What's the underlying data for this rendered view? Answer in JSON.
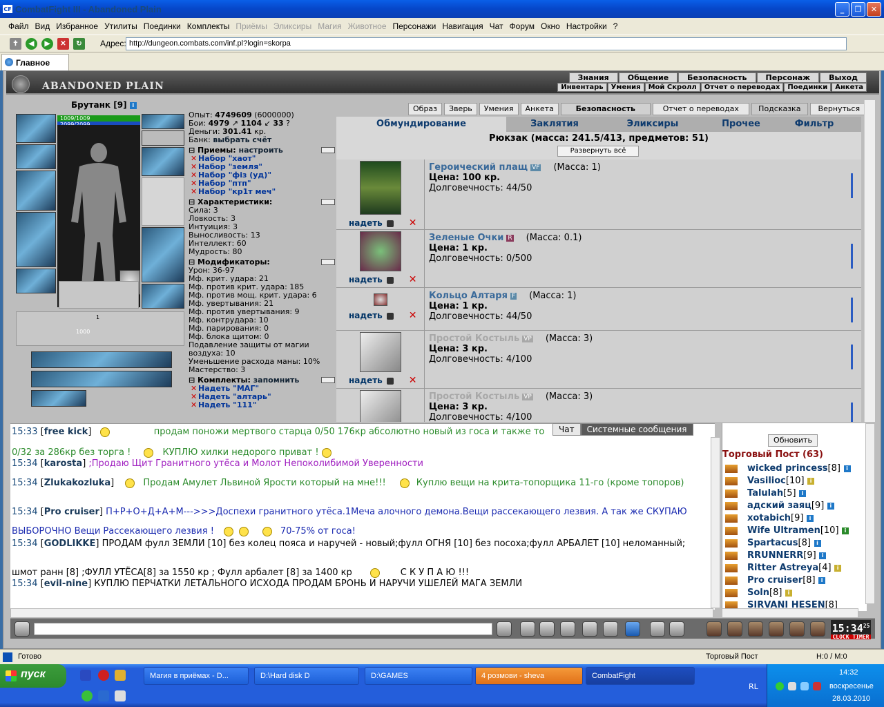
{
  "window": {
    "title": "CombatFight III - Abandoned Plain",
    "app_icon": "CF"
  },
  "menu": [
    {
      "label": "Файл",
      "enabled": true
    },
    {
      "label": "Вид",
      "enabled": true
    },
    {
      "label": "Избранное",
      "enabled": true
    },
    {
      "label": "Утилиты",
      "enabled": true
    },
    {
      "label": "Поединки",
      "enabled": true
    },
    {
      "label": "Комплекты",
      "enabled": true
    },
    {
      "label": "Приёмы",
      "enabled": false
    },
    {
      "label": "Эликсиры",
      "enabled": false
    },
    {
      "label": "Магия",
      "enabled": false
    },
    {
      "label": "Животное",
      "enabled": false
    },
    {
      "label": "Персонажи",
      "enabled": true
    },
    {
      "label": "Навигация",
      "enabled": true
    },
    {
      "label": "Чат",
      "enabled": true
    },
    {
      "label": "Форум",
      "enabled": true
    },
    {
      "label": "Окно",
      "enabled": true
    },
    {
      "label": "Настройки",
      "enabled": true
    },
    {
      "label": "?",
      "enabled": true
    }
  ],
  "address": {
    "label": "Адрес:",
    "url": "http://dungeon.combats.com/inf.pl?login=skorpa"
  },
  "browser_tab": {
    "label": "Главное"
  },
  "game": {
    "title": "ABANDONED PLAIN",
    "nav1": [
      "Знания",
      "Общение",
      "Безопасность",
      "Персонаж",
      "Выход"
    ],
    "nav2": [
      "Инвентарь",
      "Умения",
      "Мой Скролл",
      "Отчет о переводах",
      "Поединки",
      "Анкета"
    ]
  },
  "character": {
    "name": "Брутанк",
    "level": "[9]",
    "hp": "1009/1009",
    "mp": "2099/2099",
    "stack_count": "1000",
    "stack_count2": "1"
  },
  "stats": {
    "exp": {
      "label": "Опыт:",
      "value": "4749609",
      "extra": "(6000000)"
    },
    "fights": {
      "label": "Бои:",
      "wins": "4979",
      "losses": "1104",
      "draws": "33"
    },
    "money": {
      "label": "Деньги:",
      "value": "301.41",
      "unit": "кр."
    },
    "bank": {
      "label": "Банк:",
      "link": "выбрать счёт"
    },
    "tricks": {
      "title": "Приемы:",
      "link": "настроить",
      "sets": [
        "Набор \"хаот\"",
        "Набор \"земля\"",
        "Набор \"фіз (уд)\"",
        "Набор \"птп\"",
        "Набор \"кр1т меч\""
      ]
    },
    "chars": {
      "title": "Характеристики:",
      "lines": [
        "Сила: 3",
        "Ловкость: 3",
        "Интуиция: 3",
        "Выносливость: 13",
        "Интеллект: 60",
        "Мудрость: 80"
      ]
    },
    "mods": {
      "title": "Модификаторы:",
      "lines": [
        "Урон: 36-97",
        "Мф. крит. удара: 21",
        "Мф. против крит. удара: 185",
        "Мф. против мощ. крит. удара: 6",
        "Мф. увертывания: 21",
        "Мф. против увертывания: 9",
        "Мф. контрудара: 10",
        "Мф. парирования: 0",
        "Мф. блока щитом: 0",
        "Подавление защиты от магии",
        "воздуха: 10",
        "Уменьшение расхода маны: 10%",
        "Мастерство: 3"
      ]
    },
    "kits": {
      "title": "Комплекты:",
      "link": "запомнить",
      "sets": [
        "Надеть \"МАГ\"",
        "Надеть \"алтарь\"",
        "Надеть \"111\""
      ]
    }
  },
  "buttons": [
    "Образ",
    "Зверь",
    "Умения",
    "Анкета",
    "Безопасность",
    "Отчет о переводах",
    "Подсказка",
    "Вернуться"
  ],
  "inv_tabs": [
    "Обмундирование",
    "Заклятия",
    "Эликсиры",
    "Прочее",
    "Фильтр"
  ],
  "backpack": {
    "text": "Рюкзак (масса: 241.5/413, предметов: 51)",
    "expand": "Развернуть всё"
  },
  "items": [
    {
      "name": "Героический плащ",
      "tag": "VF",
      "mass": "(Масса: 1)",
      "price": "Цена: 100 кр.",
      "dur": "Долговечность: 44/50",
      "wear": "надеть",
      "grey": false
    },
    {
      "name": "Зеленые Очки",
      "tag": "R",
      "mass": "(Масса: 0.1)",
      "price": "Цена: 1 кр.",
      "dur": "Долговечность: 0/500",
      "wear": "надеть",
      "grey": false
    },
    {
      "name": "Кольцо Алтаря",
      "tag": "F",
      "mass": "(Масса: 1)",
      "price": "Цена: 1 кр.",
      "dur": "Долговечность: 44/50",
      "wear": "надеть",
      "grey": false
    },
    {
      "name": "Простой Костыль",
      "tag": "VP",
      "mass": "(Масса: 3)",
      "price": "Цена: 3 кр.",
      "dur": "Долговечность: 4/100",
      "wear": "надеть",
      "grey": true
    },
    {
      "name": "Простой Костыль",
      "tag": "VP",
      "mass": "(Масса: 3)",
      "price": "Цена: 3 кр.",
      "dur": "Долговечность: 4/100",
      "wear": "",
      "grey": true
    }
  ],
  "chat_tabs": [
    "Чат",
    "Системные сообщения"
  ],
  "chat": [
    {
      "time": "15:33",
      "nick": "free kick",
      "text": "продам поножи мертвого старца 0/50 176кр абсолютно новый из госа и также то",
      "color": "green"
    },
    {
      "time": "",
      "nick": "",
      "text": "0/32 за 286кр без торга ! ",
      "text2": "КУПЛЮ хилки недорого приват !",
      "color": "green"
    },
    {
      "time": "15:34",
      "nick": "karosta",
      "text": ";Продаю Щит Гранитного утёса и Молот Непоколибимой Уверенности",
      "color": "purple"
    },
    {
      "time": "15:34",
      "nick": "Zlukakozluka",
      "text": "Продам Амулет Львиной Ярости который на мне!!!",
      "text2": "Куплю вещи на крита-топорщика 11-го (кроме топоров)",
      "color": "green"
    },
    {
      "time": "15:34",
      "nick": "Pro cruiser",
      "text": "П+Р+О+Д+А+М--->>>Доспехи гранитного утёса.1Меча алочного демона.Вещи рассекающего лезвия. А так же СКУПАЮ",
      "color": "blue"
    },
    {
      "time": "",
      "nick": "",
      "text": "ВЫБОРОЧНО Вещи Рассекающего лезвия !",
      "text2": "70-75% от госа!",
      "color": "blue"
    },
    {
      "time": "15:34",
      "nick": "GODLIKKE",
      "text": "ПРОДАМ фулл ЗЕМЛИ [10] без колец пояса и наручей - новый;фулл ОГНЯ [10] без посоха;фулл АРБАЛЕТ [10] неломанный;",
      "color": "black"
    },
    {
      "time": "",
      "nick": "",
      "text": "шмот ранн [8] ;ФУЛЛ УТЁСА[8] за 1550 кр ; Фулл арбалет [8] за 1400 кр",
      "text2": "С К У П А Ю !!!",
      "color": "black"
    },
    {
      "time": "15:34",
      "nick": "evil-nine",
      "text": "КУПЛЮ ПЕРЧАТКИ ЛЕТАЛЬНОГО ИСХОДА ПРОДАМ БРОНЬ И НАРУЧИ УШЕЛЕЙ МАГА ЗЕМЛИ",
      "color": "black"
    }
  ],
  "trade": {
    "refresh": "Обновить",
    "title": "Торговый Пост (63)",
    "users": [
      {
        "nick": "wicked princess",
        "lvl": "[8]"
      },
      {
        "nick": "Vasilioc",
        "lvl": "[10]"
      },
      {
        "nick": "Talulah",
        "lvl": "[5]"
      },
      {
        "nick": "адский заяц",
        "lvl": "[9]"
      },
      {
        "nick": "xotabich",
        "lvl": "[9]"
      },
      {
        "nick": "Wife Ultramen",
        "lvl": "[10]"
      },
      {
        "nick": "Spartacus",
        "lvl": "[8]"
      },
      {
        "nick": "RRUNNERR",
        "lvl": "[9]"
      },
      {
        "nick": "Ritter Astreya",
        "lvl": "[4]"
      },
      {
        "nick": "Pro cruiser",
        "lvl": "[8]"
      },
      {
        "nick": "Soln",
        "lvl": "[8]"
      },
      {
        "nick": "SIRVANI HESEN",
        "lvl": "[8]"
      }
    ]
  },
  "clock": {
    "time": "15:34",
    "sec": "25",
    "label1": "CLOCK",
    "label2": "TIMER"
  },
  "status": {
    "ready": "Готово",
    "post": "Торговый Пост",
    "hm": "H:0 / M:0"
  },
  "taskbar": {
    "start": "пуск",
    "tasks": [
      "Магия в приёмах - D...",
      "D:\\Hard disk D",
      "D:\\GAMES",
      "4 розмови - sheva",
      "CombatFight"
    ],
    "lang": "RL",
    "time": "14:32",
    "day": "воскресенье",
    "date": "28.03.2010"
  }
}
